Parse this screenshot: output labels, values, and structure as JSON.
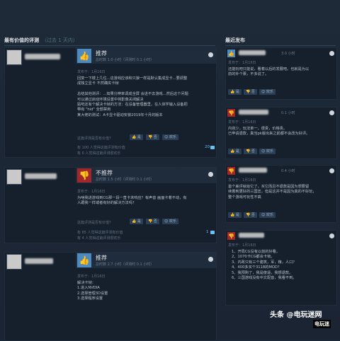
{
  "left_header": {
    "title": "最有价值的评测",
    "sub": "（过去 1 天内）"
  },
  "right_header": {
    "title": "最近发布"
  },
  "reviews": [
    {
      "verdict": "推荐",
      "hours": "总时数 1.0 小时（评测时 0.1 小时）",
      "date": "发布于：1月16日",
      "body": "回复一下楼上几位...这游戏应该和只狼一样是默认集成显卡...要调整\n成独立显卡 不然确实卡帧\n\n总结其他测评：...如果分辨率调成全屏 会进不去游戏...然后这个问题\n可以通过启动环境设置中将影像关闭解决\n贴吧还有个解决卡帧的方法：在设备管理器里，在人体学输入设备把\n带有 \"hid\" 全部禁用\n某大佬的测试：A卡显卡驱动安装2019年十月的版本",
      "question": "这篇评测是否有价值？",
      "buttons": [
        "是",
        "否",
        "欢乐"
      ],
      "stats": [
        "有 100 人觉得这篇评测有价值",
        "有 6 人觉得这篇评测很欢乐"
      ],
      "comments": "20"
    },
    {
      "verdict": "不推荐",
      "hours": "总时数 1.5 小时（评测时 0.1 小时）",
      "date": "发布于：1月16日",
      "body": "为啥我进游戏到CG那一段一直卡未响应？有声音 画面卡着不动，有\n人跟我一样或者有好的解决方法吗？",
      "question": "这篇评测是否有价值？",
      "buttons": [
        "是",
        "否",
        "欢乐"
      ],
      "stats": [
        "有 85 人觉得这篇评测有价值",
        "有 4 人觉得这篇评测很欢乐"
      ],
      "comments": "1"
    },
    {
      "verdict": "推荐",
      "hours": "总时数 2.7 小时（评测时 0.1 小时）",
      "date": "发布于：1月16日",
      "body": "解决卡帧：\n1.进入NVDIA\n2.选择管理3D设置\n3.选择程序设置"
    }
  ],
  "recent": [
    {
      "hours": "3.0 小时",
      "date": "发布于：1月16日",
      "body": "还能玩吧只能说，看着以后的发展吧。也就是为以\n前的补个票，不多说了。",
      "buttons": [
        "是",
        "否",
        "欢乐"
      ]
    },
    {
      "hours": "0.1 小时",
      "date": "发布于：1月16日",
      "body": "内容少，玩法单一，很贵，价格贵。\n已申请退款，真当pk版出来之前都不会改为好评。",
      "buttons": [
        "是",
        "否",
        "欢乐"
      ]
    },
    {
      "hours": "0.4 小时",
      "date": "发布于：1月16日",
      "body": "首个差评就给它了，买它而且不退款是因为想要留\n续着到更好的三国志，但是这并不是因为真的不好玩，\n整个游戏可玩性不高",
      "buttons": [
        "是",
        "否",
        "欢乐"
      ]
    },
    {
      "hours": "",
      "date": "发布于：1月16日",
      "body": "1、开局CG没有以前的好看。\n2、1070卡CG都会卡帧。\n3、内政只有三个建筑，军，粮，人口？\n4、400多买个3118的MOD？\n5、我预购了，我是傻逼，我想退款。\n6、三国游戏没有中文配音，我看不到。"
    }
  ],
  "watermark": {
    "text": "头条 @电玩迷网",
    "badge": "电玩迷"
  }
}
